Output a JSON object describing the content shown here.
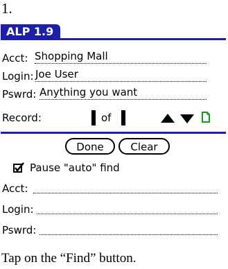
{
  "step_number": "1.",
  "caption": "Tap on the “Find” button.",
  "app": {
    "title": "ALP 1.9",
    "accent_color": "#1d1fa8"
  },
  "record_fields": {
    "acct_label": "Acct:",
    "acct_value": "Shopping Mall",
    "login_label": "Login:",
    "login_value": "Joe User",
    "pswd_label": "Pswrd:",
    "pswd_value": "Anything you want"
  },
  "record_nav": {
    "label": "Record:",
    "of_text": "of",
    "up_icon": "arrow-up-icon",
    "down_icon": "arrow-down-icon",
    "note_icon": "note-icon"
  },
  "find_panel": {
    "done_label": "Done",
    "clear_label": "Clear",
    "pause_label": "Pause \"auto\" find",
    "pause_checked": true,
    "acct_label": "Acct:",
    "login_label": "Login:",
    "pswd_label": "Pswrd:"
  }
}
